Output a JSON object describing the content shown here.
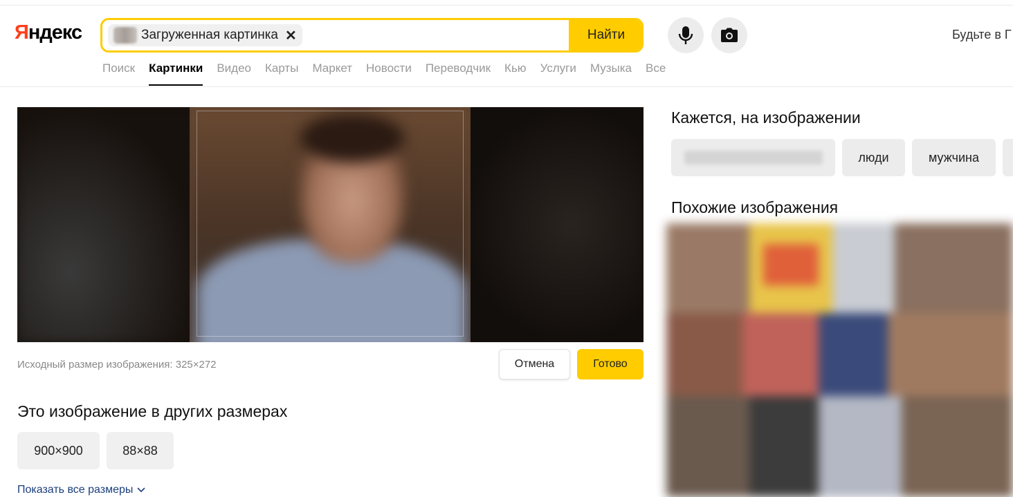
{
  "logo": {
    "first": "Я",
    "rest": "ндекс"
  },
  "search": {
    "chip_label": "Загруженная картинка",
    "chip_close": "✕",
    "button": "Найти"
  },
  "header": {
    "promo": "Будьте в Г"
  },
  "nav": {
    "items": [
      {
        "label": "Поиск"
      },
      {
        "label": "Картинки",
        "active": true
      },
      {
        "label": "Видео"
      },
      {
        "label": "Карты"
      },
      {
        "label": "Маркет"
      },
      {
        "label": "Новости"
      },
      {
        "label": "Переводчик"
      },
      {
        "label": "Кью"
      },
      {
        "label": "Услуги"
      },
      {
        "label": "Музыка"
      },
      {
        "label": "Все"
      }
    ]
  },
  "preview": {
    "caption": "Исходный размер изображения: 325×272",
    "cancel": "Отмена",
    "done": "Готово"
  },
  "sizes": {
    "title": "Это изображение в других размерах",
    "items": [
      "900×900",
      "88×88"
    ],
    "show_all": "Показать все размеры"
  },
  "tags": {
    "title": "Кажется, на изображении",
    "items": [
      "люди",
      "мужчина"
    ]
  },
  "similar": {
    "title": "Похожие изображения"
  },
  "colors": {
    "accent": "#ffcc00",
    "logo_red": "#fc3f1d",
    "link": "#1a3d7c"
  },
  "icons": [
    "mic-icon",
    "camera-icon",
    "close-icon",
    "chevron-down-icon"
  ]
}
